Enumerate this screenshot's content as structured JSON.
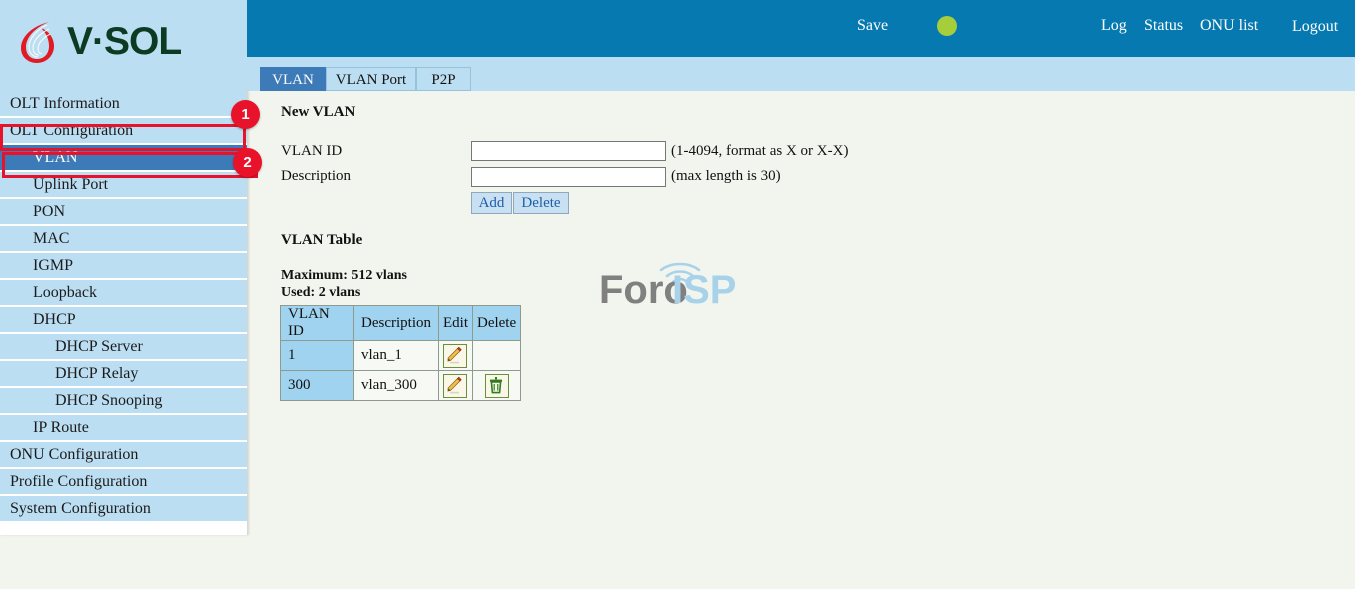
{
  "header": {
    "brand": "V·SOL",
    "save_label": "Save",
    "status_dot_color": "#a6ce3a",
    "links": {
      "log": "Log",
      "status": "Status",
      "onu_list": "ONU list",
      "logout": "Logout"
    }
  },
  "tabs": [
    {
      "label": "VLAN",
      "active": true
    },
    {
      "label": "VLAN Port",
      "active": false
    },
    {
      "label": "P2P",
      "active": false
    }
  ],
  "sidebar": {
    "items": [
      {
        "label": "OLT Information",
        "level": 0,
        "active": false
      },
      {
        "label": "OLT Configuration",
        "level": 0,
        "active": false
      },
      {
        "label": "VLAN",
        "level": 1,
        "active": true
      },
      {
        "label": "Uplink Port",
        "level": 1,
        "active": false
      },
      {
        "label": "PON",
        "level": 1,
        "active": false
      },
      {
        "label": "MAC",
        "level": 1,
        "active": false
      },
      {
        "label": "IGMP",
        "level": 1,
        "active": false
      },
      {
        "label": "Loopback",
        "level": 1,
        "active": false
      },
      {
        "label": "DHCP",
        "level": 1,
        "active": false
      },
      {
        "label": "DHCP Server",
        "level": 2,
        "active": false
      },
      {
        "label": "DHCP Relay",
        "level": 2,
        "active": false
      },
      {
        "label": "DHCP Snooping",
        "level": 2,
        "active": false
      },
      {
        "label": "IP Route",
        "level": 1,
        "active": false
      },
      {
        "label": "ONU Configuration",
        "level": 0,
        "active": false
      },
      {
        "label": "Profile Configuration",
        "level": 0,
        "active": false
      },
      {
        "label": "System Configuration",
        "level": 0,
        "active": false
      }
    ]
  },
  "new_vlan": {
    "title": "New VLAN",
    "vlan_id_label": "VLAN ID",
    "vlan_id_value": "",
    "vlan_id_hint": "(1-4094, format as X or X-X)",
    "description_label": "Description",
    "description_value": "",
    "description_hint": "(max length is 30)",
    "add_label": "Add",
    "delete_label": "Delete"
  },
  "vlan_table": {
    "title": "VLAN Table",
    "maximum_text": "Maximum: 512 vlans",
    "used_text": "Used: 2 vlans",
    "columns": [
      "VLAN ID",
      "Description",
      "Edit",
      "Delete"
    ],
    "rows": [
      {
        "vlan_id": "1",
        "description": "vlan_1",
        "edit_icon": "pencil-icon",
        "delete_icon": ""
      },
      {
        "vlan_id": "300",
        "description": "vlan_300",
        "edit_icon": "pencil-icon",
        "delete_icon": "trash-icon"
      }
    ]
  },
  "watermark": {
    "text_primary": "Foro",
    "text_secondary": "ISP",
    "primary_color": "#808080",
    "secondary_color": "#a8d2ea"
  },
  "annotations": [
    {
      "badge": "1",
      "target": "OLT Configuration"
    },
    {
      "badge": "2",
      "target": "VLAN"
    }
  ],
  "colors": {
    "header_blue": "#0679b0",
    "sidebar_blue": "#bcdef2",
    "active_blue": "#3d7ab8",
    "annotation_red": "#e8132a",
    "content_bg": "#f2f5ee"
  }
}
